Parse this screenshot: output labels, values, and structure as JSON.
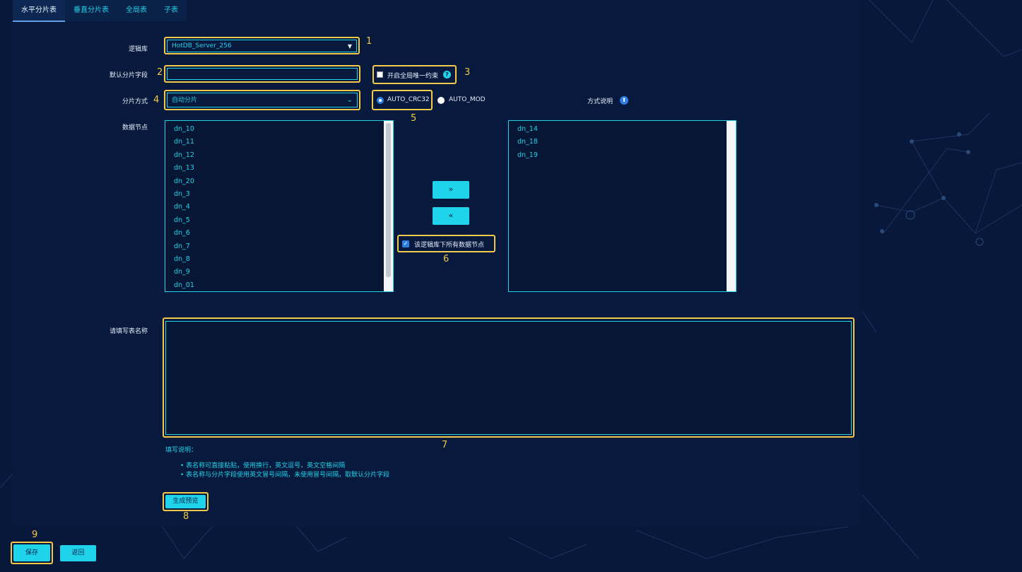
{
  "tabs": [
    {
      "label": "水平分片表",
      "active": true
    },
    {
      "label": "垂直分片表",
      "active": false
    },
    {
      "label": "全局表",
      "active": false
    },
    {
      "label": "子表",
      "active": false
    }
  ],
  "form": {
    "logic_db_label": "逻辑库",
    "logic_db_value": "HotDB_Server_256",
    "default_shard_field_label": "默认分片字段",
    "default_shard_field_value": "",
    "global_unique_label": "开启全局唯一约束",
    "global_unique_checked": false,
    "shard_mode_label": "分片方式",
    "shard_mode_value": "自动分片",
    "radio_crc32_label": "AUTO_CRC32",
    "radio_mod_label": "AUTO_MOD",
    "selected_algorithm": "AUTO_CRC32",
    "mode_desc_label": "方式说明",
    "data_nodes_label": "数据节点",
    "available_nodes": [
      "dn_10",
      "dn_11",
      "dn_12",
      "dn_13",
      "dn_20",
      "dn_3",
      "dn_4",
      "dn_5",
      "dn_6",
      "dn_7",
      "dn_8",
      "dn_9",
      "dn_01"
    ],
    "selected_nodes": [
      "dn_14",
      "dn_18",
      "dn_19"
    ],
    "move_right_label": "»",
    "move_left_label": "«",
    "all_nodes_label": "该逻辑库下所有数据节点",
    "all_nodes_checked": true,
    "table_names_label": "请填写表名称",
    "table_names_value": "",
    "fill_instruction_title": "填写说明：",
    "fill_instructions": [
      "表名称可直接粘贴，使用换行，英文逗号，英文空格间隔",
      "表名称与分片字段使用英文冒号间隔，未使用冒号间隔，取默认分片字段"
    ],
    "generate_preview_label": "生成预览"
  },
  "footer": {
    "save_label": "保存",
    "back_label": "返回"
  },
  "annotations": [
    "1",
    "2",
    "3",
    "4",
    "5",
    "6",
    "7",
    "8",
    "9"
  ],
  "colors": {
    "background": "#08183a",
    "accent_cyan": "#1ed3ea",
    "highlight_yellow": "#f3c94a"
  }
}
